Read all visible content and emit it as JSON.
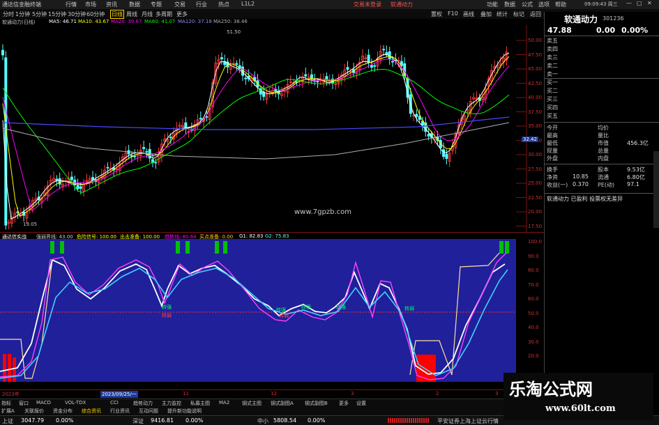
{
  "titlebar": {
    "app": "通达信金融终端",
    "menus": [
      "行情",
      "市场",
      "资讯",
      "数据",
      "专题",
      "交易",
      "行业",
      "热点",
      "L1L2"
    ],
    "center_links": [
      "交易未登录",
      "软通动力"
    ],
    "right": [
      "功能",
      "数据",
      "公式",
      "选项",
      "帮助"
    ],
    "time": "09:09:43 周三"
  },
  "menubar": {
    "periods": [
      "分时",
      "1分钟",
      "5分钟",
      "15分钟",
      "30分钟",
      "60分钟",
      "日线",
      "周线",
      "月线",
      "多周期",
      "更多"
    ],
    "active": "日线",
    "right_tools": [
      "置权",
      "F10",
      "画线",
      "叠加",
      "统计",
      "标记",
      "返回"
    ]
  },
  "ma_legend": {
    "name": "软通动力(日线)",
    "ma5": "MA5: 46.71",
    "ma10": "MA10: 43.67",
    "ma20": "MA20: 39.67",
    "ma60": "MA60: 41.07",
    "ma120": "MA120: 37.18",
    "ma250": "MA250: 38.46"
  },
  "colors": {
    "up": "#ff3b3b",
    "down": "#54ffff",
    "ma5": "#ffffff",
    "ma10": "#ffff00",
    "ma20": "#ff00ff",
    "ma60": "#00ff00",
    "ma120": "#4848ff",
    "ma250": "#b0b0b0",
    "sub_bg": "#20209a"
  },
  "main_axis": [
    "50.00",
    "47.50",
    "45.00",
    "42.50",
    "40.00",
    "37.50",
    "35.00",
    "32.50",
    "30.00",
    "27.50",
    "25.00",
    "22.50",
    "20.00",
    "17.50"
  ],
  "price_marker": "32.42",
  "annotations": {
    "high": "51.50",
    "low": "19.05"
  },
  "watermark_center": "www.7gpzb.com",
  "sub_legend": {
    "name": "通达信实战",
    "items": [
      "强弱界线: 43.00",
      "危险信号: 100.00",
      "出击准备: 100.00",
      "趋势线: 80.64",
      "买点准备: 0.00",
      "G1: 82.83",
      "G2: 75.83"
    ]
  },
  "sub_axis": [
    "100.0",
    "90.0",
    "80.0",
    "70.0",
    "60.0",
    "50.0",
    "40.0",
    "30.0",
    "20.0"
  ],
  "sub_labels": [
    "转强",
    "转强",
    "转强",
    "转强",
    "转弱",
    "转弱",
    "转弱"
  ],
  "date_axis": [
    "2023年",
    "2023/09/25/一",
    "11",
    "12",
    "3",
    "2",
    "3"
  ],
  "quote": {
    "name": "软通动力",
    "code": "301236",
    "price": "47.88",
    "change": "0.00",
    "pct": "0.00%",
    "sells": [
      "卖五",
      "卖四",
      "卖三",
      "卖二",
      "卖一"
    ],
    "buys": [
      "买一",
      "买二",
      "买三",
      "买四",
      "买五"
    ],
    "stats": [
      {
        "l": "今开",
        "v": "",
        "l2": "均价",
        "v2": ""
      },
      {
        "l": "最高",
        "v": "",
        "l2": "量比",
        "v2": ""
      },
      {
        "l": "最低",
        "v": "",
        "l2": "市值",
        "v2": "456.3亿"
      },
      {
        "l": "现量",
        "v": "",
        "l2": "总量",
        "v2": ""
      },
      {
        "l": "外盘",
        "v": "",
        "l2": "内盘",
        "v2": ""
      }
    ],
    "stats2": [
      {
        "l": "换手",
        "v": "",
        "l2": "股本",
        "v2": "9.53亿"
      },
      {
        "l": "净资",
        "v": "10.85",
        "l2": "流通",
        "v2": "6.80亿"
      },
      {
        "l": "收益(一)",
        "v": "0.370",
        "l2": "PE(动)",
        "v2": "97.1"
      }
    ],
    "footer": "软通动力 已盈利 投票权无差异"
  },
  "bottom_tabs": {
    "row1": [
      "指标",
      "窗口",
      "MACD",
      "VOL-TDX",
      "CCI",
      "趋势动力",
      "主力监控",
      "私募主图",
      "MA2",
      "钢式主图",
      "钢式副图A",
      "钢式副图B",
      "更多",
      "设置"
    ],
    "row2": [
      "扩展A",
      "关联报价",
      "资金分布",
      "综合资讯",
      "行业资讯",
      "互动问题",
      "提升新功能说明"
    ]
  },
  "status": {
    "sh_label": "上证",
    "sh_val": "3047.79",
    "sh_pct": "0.00%",
    "sz_label": "深证",
    "sz_val": "9416.81",
    "sz_pct": "0.00%",
    "cy_label": "中小",
    "cy_val": "5808.54",
    "cy_pct": "0.00%",
    "broker": "平安证券上海上证云行情"
  },
  "watermark": {
    "line1": "乐淘公式网",
    "line2": "www.60lt.com"
  }
}
